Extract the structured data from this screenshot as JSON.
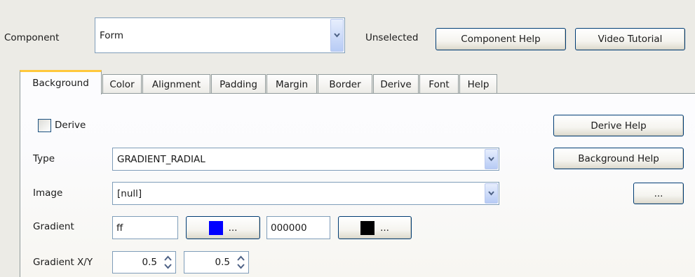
{
  "header": {
    "component_label": "Component",
    "component_value": "Form",
    "status_text": "Unselected",
    "component_help_label": "Component Help",
    "video_tutorial_label": "Video Tutorial"
  },
  "tabs": [
    {
      "label": "Background",
      "active": true
    },
    {
      "label": "Color"
    },
    {
      "label": "Alignment"
    },
    {
      "label": "Padding"
    },
    {
      "label": "Margin"
    },
    {
      "label": "Border"
    },
    {
      "label": "Derive"
    },
    {
      "label": "Font"
    },
    {
      "label": "Help"
    }
  ],
  "panel": {
    "derive_label": "Derive",
    "derive_checked": false,
    "derive_help_label": "Derive Help",
    "type_label": "Type",
    "type_value": "GRADIENT_RADIAL",
    "background_help_label": "Background Help",
    "image_label": "Image",
    "image_value": "[null]",
    "image_browse_label": "...",
    "gradient_label": "Gradient",
    "gradient_start_value": "ff",
    "gradient_start_color": "#0000ff",
    "gradient_start_button_label": "...",
    "gradient_end_value": "000000",
    "gradient_end_color": "#000000",
    "gradient_end_button_label": "...",
    "gradient_xy_label": "Gradient X/Y",
    "gradient_x_value": "0.5",
    "gradient_y_value": "0.5"
  },
  "colors": {
    "accent_tab": "#ffc83c",
    "button_border": "#003c74",
    "field_border": "#7f9db9"
  }
}
